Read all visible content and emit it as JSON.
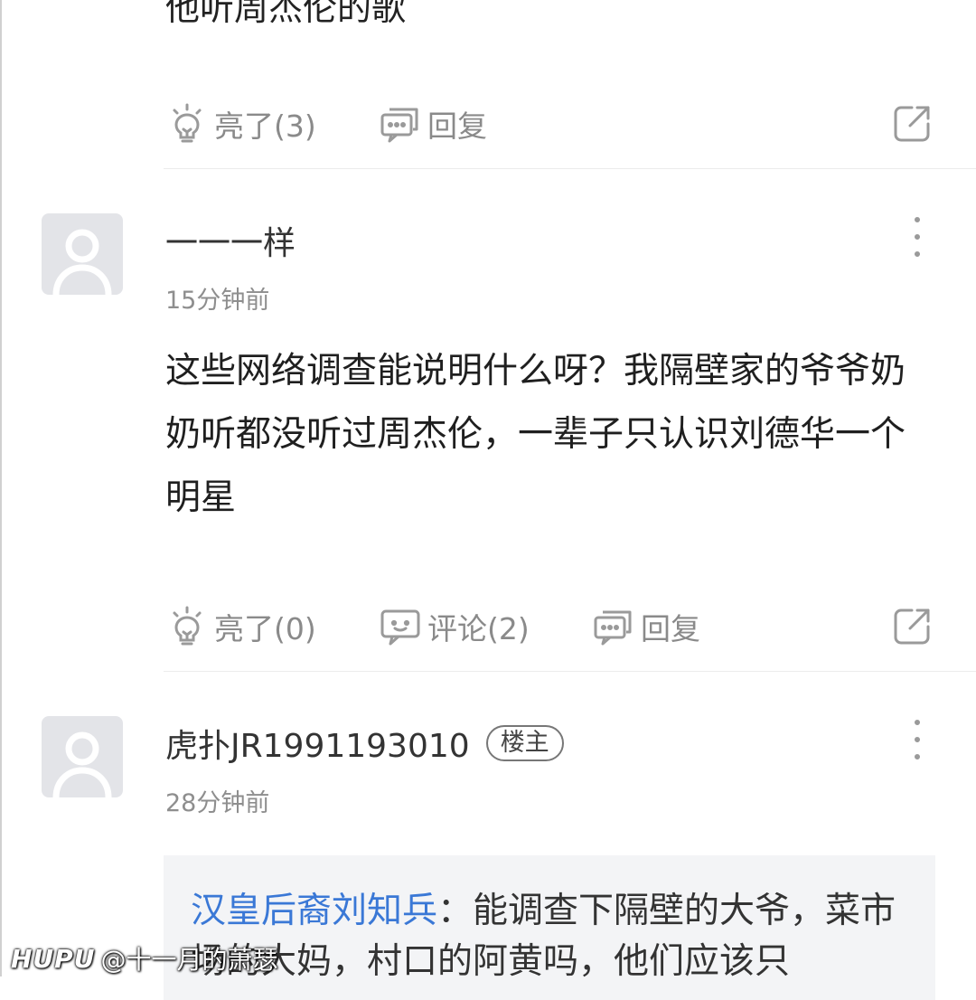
{
  "top_fragment": {
    "text": "他听周杰伦的歌",
    "actions": {
      "like_label": "亮了(3)",
      "reply_label": "回复"
    }
  },
  "comments": [
    {
      "username": "一一一样",
      "time": "15分钟前",
      "content": "这些网络调查能说明什么呀？我隔壁家的爷爷奶奶听都没听过周杰伦，一辈子只认识刘德华一个明星",
      "actions": {
        "like_label": "亮了(0)",
        "comment_label": "评论(2)",
        "reply_label": "回复"
      }
    },
    {
      "username": "虎扑JR1991193010",
      "badge": "楼主",
      "time": "28分钟前",
      "quote": {
        "author": "汉皇后裔刘知兵",
        "separator": "：",
        "text": "能调查下隔壁的大爷，菜市场的大妈，村口的阿黄吗，他们应该只"
      }
    }
  ],
  "watermark": {
    "logo": "HUPU",
    "text": "@十一月的萧瑟"
  },
  "colors": {
    "link": "#3a78d6",
    "muted": "#8a8a8a",
    "quote_bg": "#f3f4f6",
    "avatar_bg": "#e3e4e8"
  },
  "icons": [
    "bulb-icon",
    "reply-bubble-icon",
    "comment-bubble-icon",
    "share-icon",
    "more-vertical-icon",
    "avatar-placeholder-icon"
  ]
}
